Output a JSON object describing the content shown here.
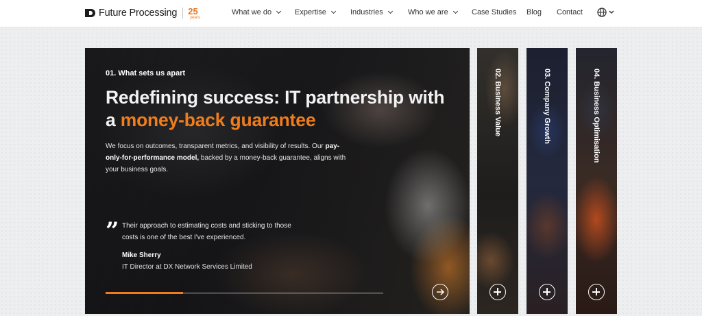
{
  "brand": {
    "name": "Future Processing",
    "years_number": "25",
    "years_word": "years",
    "accent_color": "#f07d1c"
  },
  "nav": {
    "items": [
      {
        "label": "What we do",
        "has_dropdown": true
      },
      {
        "label": "Expertise",
        "has_dropdown": true
      },
      {
        "label": "Industries",
        "has_dropdown": true
      },
      {
        "label": "Who we are",
        "has_dropdown": true
      },
      {
        "label": "Case Studies",
        "has_dropdown": false
      },
      {
        "label": "Blog",
        "has_dropdown": false
      },
      {
        "label": "Contact",
        "has_dropdown": false
      }
    ],
    "language_icon": "globe-icon"
  },
  "slide": {
    "eyebrow": "01. What sets us apart",
    "headline_part1": "Redefining success: IT partnership with a ",
    "headline_accent": "money-back guarantee",
    "desc_part1": "We focus on outcomes, transparent metrics, and visibility of results. Our ",
    "desc_bold": "pay-only-for-performance model,",
    "desc_part2": " backed by a money-back guarantee, aligns with your business goals.",
    "quote": "Their approach to estimating costs and sticking to those costs is one of the best I've experienced.",
    "author_name": "Mike Sherry",
    "author_role": "IT Director at DX Network Services Limited",
    "progress_fraction": 0.28,
    "next_icon": "arrow-right-icon"
  },
  "tabs": [
    {
      "label": "02. Business Value",
      "icon": "plus-icon"
    },
    {
      "label": "03. Company Growth",
      "icon": "plus-icon"
    },
    {
      "label": "04. Business Optimisation",
      "icon": "plus-icon"
    }
  ]
}
